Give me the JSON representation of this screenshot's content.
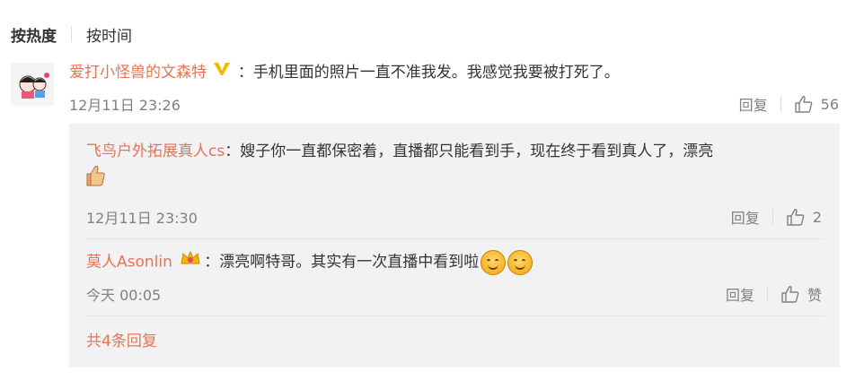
{
  "sort": {
    "active": "按热度",
    "other": "按时间"
  },
  "main_comment": {
    "username": "爱打小怪兽的文森特",
    "badge_icon": "verified-v-icon",
    "separator": "：",
    "text": "手机里面的照片一直不准我发。我感觉我要被打死了。",
    "time": "12月11日 23:26",
    "reply_label": "回复",
    "likes": "56"
  },
  "replies": [
    {
      "username": "飞鸟户外拓展真人cs",
      "separator": "：",
      "text": "嫂子你一直都保密着，直播都只能看到手，现在终于看到真人了，漂亮",
      "emoji": "thumbs-up-emoji",
      "time": "12月11日 23:30",
      "reply_label": "回复",
      "likes": "2"
    },
    {
      "username": "莫人Asonlin",
      "badge_icon": "crown-badge-icon",
      "separator": "：",
      "text": "漂亮啊特哥。其实有一次直播中看到啦",
      "emoji": "smile-emoji",
      "time": "今天 00:05",
      "reply_label": "回复",
      "likes": "赞"
    }
  ],
  "more_replies": "共4条回复",
  "colors": {
    "accent": "#eb7350",
    "muted": "#808080",
    "reply_bg": "#f2f2f5"
  }
}
